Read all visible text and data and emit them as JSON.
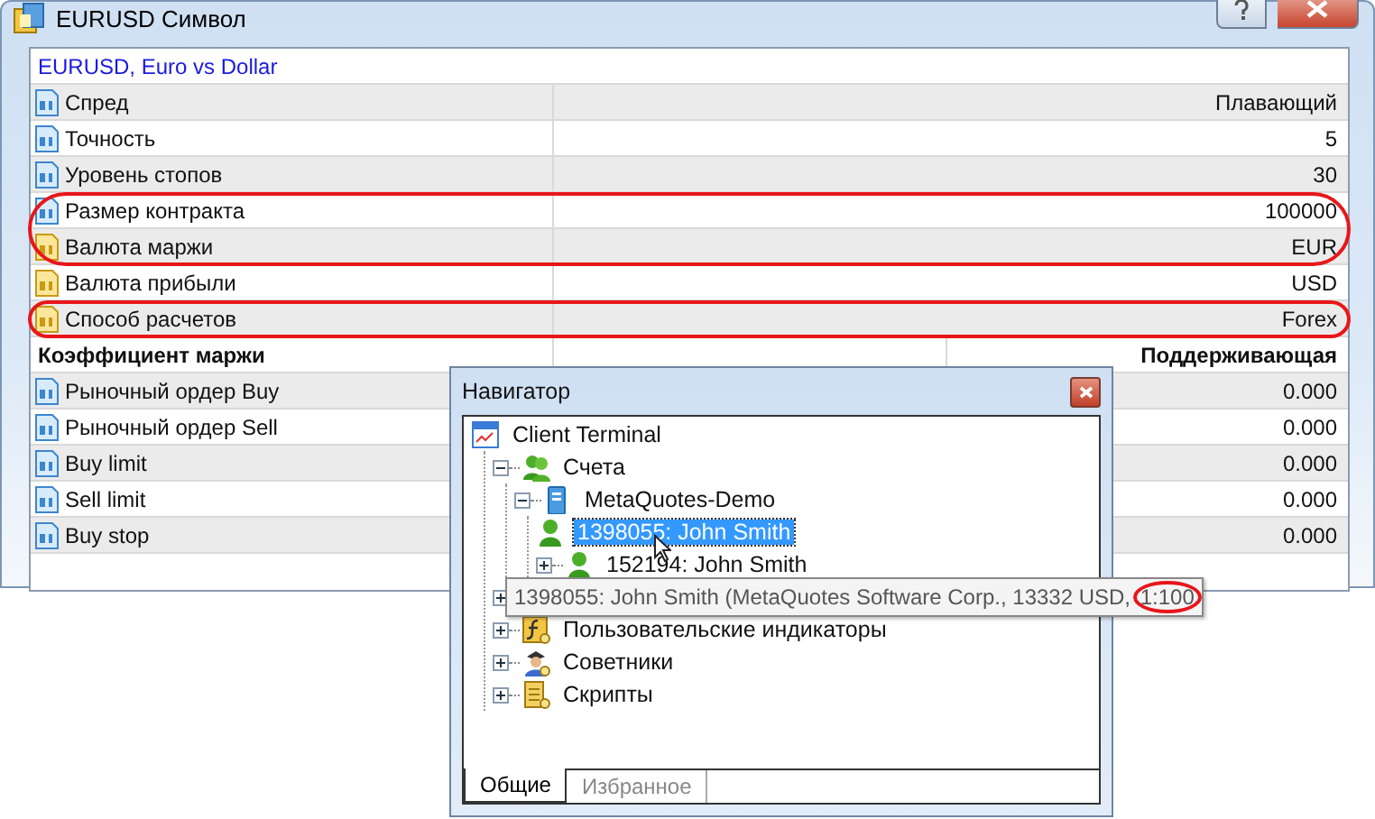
{
  "window": {
    "title": "EURUSD Символ"
  },
  "spec": {
    "header": "EURUSD, Euro vs  Dollar",
    "rows": [
      {
        "kind": "number",
        "name": "Спред",
        "value": "Плавающий",
        "highlight": false
      },
      {
        "kind": "number",
        "name": "Точность",
        "value": "5",
        "highlight": false
      },
      {
        "kind": "number",
        "name": "Уровень стопов",
        "value": "30",
        "highlight": false
      },
      {
        "kind": "number",
        "name": "Размер контракта",
        "value": "100000",
        "highlight": true
      },
      {
        "kind": "text",
        "name": "Валюта маржи",
        "value": "EUR",
        "highlight": true
      },
      {
        "kind": "text",
        "name": "Валюта прибыли",
        "value": "USD",
        "highlight": false
      },
      {
        "kind": "text",
        "name": "Способ расчетов",
        "value": "Forex",
        "highlight": true
      }
    ]
  },
  "margin": {
    "title": "Коэффициент маржи",
    "column": "Поддерживающая",
    "rows": [
      {
        "kind": "number",
        "name": "Рыночный ордер Buy",
        "value": "0.000"
      },
      {
        "kind": "number",
        "name": "Рыночный ордер Sell",
        "value": "0.000"
      },
      {
        "kind": "number",
        "name": "Buy limit",
        "value": "0.000"
      },
      {
        "kind": "number",
        "name": "Sell limit",
        "value": "0.000"
      },
      {
        "kind": "number",
        "name": "Buy stop",
        "value": "0.000"
      }
    ]
  },
  "navigator": {
    "title": "Навигатор",
    "tree": [
      {
        "label": "Client Terminal",
        "kind": "terminal",
        "children": [
          {
            "label": "Счета",
            "kind": "accounts",
            "expanded": true,
            "children": [
              {
                "label": "MetaQuotes-Demo",
                "kind": "server",
                "expanded": true,
                "children": [
                  {
                    "label": "1398055: John Smith",
                    "kind": "user",
                    "selected": true
                  },
                  {
                    "label": "152194: John Smith",
                    "kind": "user",
                    "selected": false,
                    "expanded": false
                  }
                ]
              }
            ]
          },
          {
            "expanded": false
          },
          {
            "label": "Пользовательские индикаторы",
            "kind": "custom",
            "expanded": false
          },
          {
            "label": "Советники",
            "kind": "experts",
            "expanded": false
          },
          {
            "label": "Скрипты",
            "kind": "scripts",
            "expanded": false
          }
        ]
      }
    ],
    "tabs": [
      {
        "label": "Общие",
        "selected": true
      },
      {
        "label": "Избранное",
        "selected": false
      }
    ]
  },
  "tooltip": {
    "text": "1398055: John Smith (MetaQuotes Software Corp., 13332 USD, ",
    "highlighted": "1:100"
  }
}
